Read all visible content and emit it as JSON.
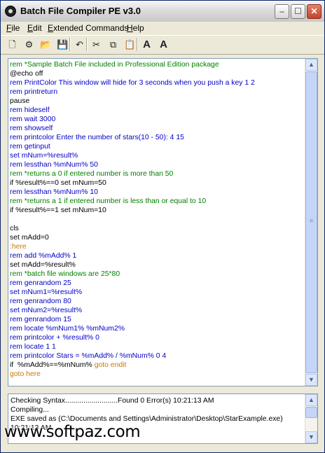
{
  "window": {
    "title": "Batch File Compiler PE v3.0"
  },
  "titlebar_buttons": {
    "minimize": "–",
    "maximize": "☐",
    "close": "✕"
  },
  "menu": [
    {
      "label": "File",
      "underline": "F",
      "rest": "ile"
    },
    {
      "label": "Edit",
      "underline": "E",
      "rest": "dit"
    },
    {
      "label": "Extended Commands",
      "underline": "E",
      "rest": "xtended Commands"
    },
    {
      "label": "Help",
      "underline": "H",
      "rest": "elp"
    }
  ],
  "toolbar": {
    "new": "🗋",
    "compile": "⚙",
    "open": "📂",
    "save": "💾",
    "undo": "↶",
    "cut": "✂",
    "copy": "⧉",
    "paste": "📋",
    "font_up": "A",
    "font_down": "A"
  },
  "editor": {
    "lines": [
      {
        "text": "rem *Sample Batch File included in Professional Edition package",
        "color": "green"
      },
      {
        "text": "@echo off",
        "color": "black"
      },
      {
        "text": "rem PrintColor This window will hide for 3 seconds when you push a key 1 2",
        "color": "blue"
      },
      {
        "text": "rem printreturn",
        "color": "blue"
      },
      {
        "text": "pause",
        "color": "black"
      },
      {
        "text": "rem hideself",
        "color": "blue"
      },
      {
        "text": "rem wait 3000",
        "color": "blue"
      },
      {
        "text": "rem showself",
        "color": "blue"
      },
      {
        "text": "rem printcolor Enter the number of stars(10 - 50): 4 15",
        "color": "blue"
      },
      {
        "text": "rem getinput",
        "color": "blue"
      },
      {
        "text": "set mNum=%result%",
        "color": "blue"
      },
      {
        "text": "rem lessthan %mNum% 50",
        "color": "blue"
      },
      {
        "text": "rem *returns a 0 if entered number is more than 50",
        "color": "green"
      },
      {
        "text": "if %result%==0 set mNum=50",
        "color": "black"
      },
      {
        "text": "rem lessthan %mNum% 10",
        "color": "blue"
      },
      {
        "text": "rem *returns a 1 if entered number is less than or equal to 10",
        "color": "green"
      },
      {
        "text": "if %result%==1 set mNum=10",
        "color": "black"
      },
      {
        "text": "",
        "color": "black"
      },
      {
        "text": "cls",
        "color": "black"
      },
      {
        "text": "set mAdd=0",
        "color": "black"
      },
      {
        "text": ":here",
        "color": "orange"
      },
      {
        "text": "rem add %mAdd% 1",
        "color": "blue"
      },
      {
        "text": "set mAdd=%result%",
        "color": "black"
      },
      {
        "text": "rem *batch file windows are 25*80",
        "color": "green"
      },
      {
        "text": "rem genrandom 25",
        "color": "blue"
      },
      {
        "text": "set mNum1=%result%",
        "color": "blue"
      },
      {
        "text": "rem genrandom 80",
        "color": "blue"
      },
      {
        "text": "set mNum2=%result%",
        "color": "blue"
      },
      {
        "text": "rem genrandom 15",
        "color": "blue"
      },
      {
        "text": "rem locate %mNum1% %mNum2%",
        "color": "blue"
      },
      {
        "text": "rem printcolor + %result% 0",
        "color": "blue"
      },
      {
        "text": "rem locate 1 1",
        "color": "blue"
      },
      {
        "text": "rem printcolor Stars = %mAdd% / %mNum% 0 4",
        "color": "blue"
      },
      {
        "text": "if  %mAdd%==%mNum% ",
        "color": "black",
        "tail": "goto endit",
        "tail_color": "orange"
      },
      {
        "text": "goto here",
        "color": "orange"
      }
    ]
  },
  "output": {
    "lines": [
      "Checking Syntax..........................Found 0 Error(s) 10:21:13 AM",
      "Compiling...",
      "EXE saved as (C:\\Documents and Settings\\Administrator\\Desktop\\StarExample.exe)",
      "10:21:13 AM"
    ]
  },
  "scroll_icons": {
    "up": "▲",
    "down": "▼",
    "grip": "≡"
  },
  "colors": {
    "green": "#008000",
    "blue": "#0000c8",
    "black": "#000000",
    "orange": "#c8780a"
  },
  "watermark": "www.softpaz.com"
}
